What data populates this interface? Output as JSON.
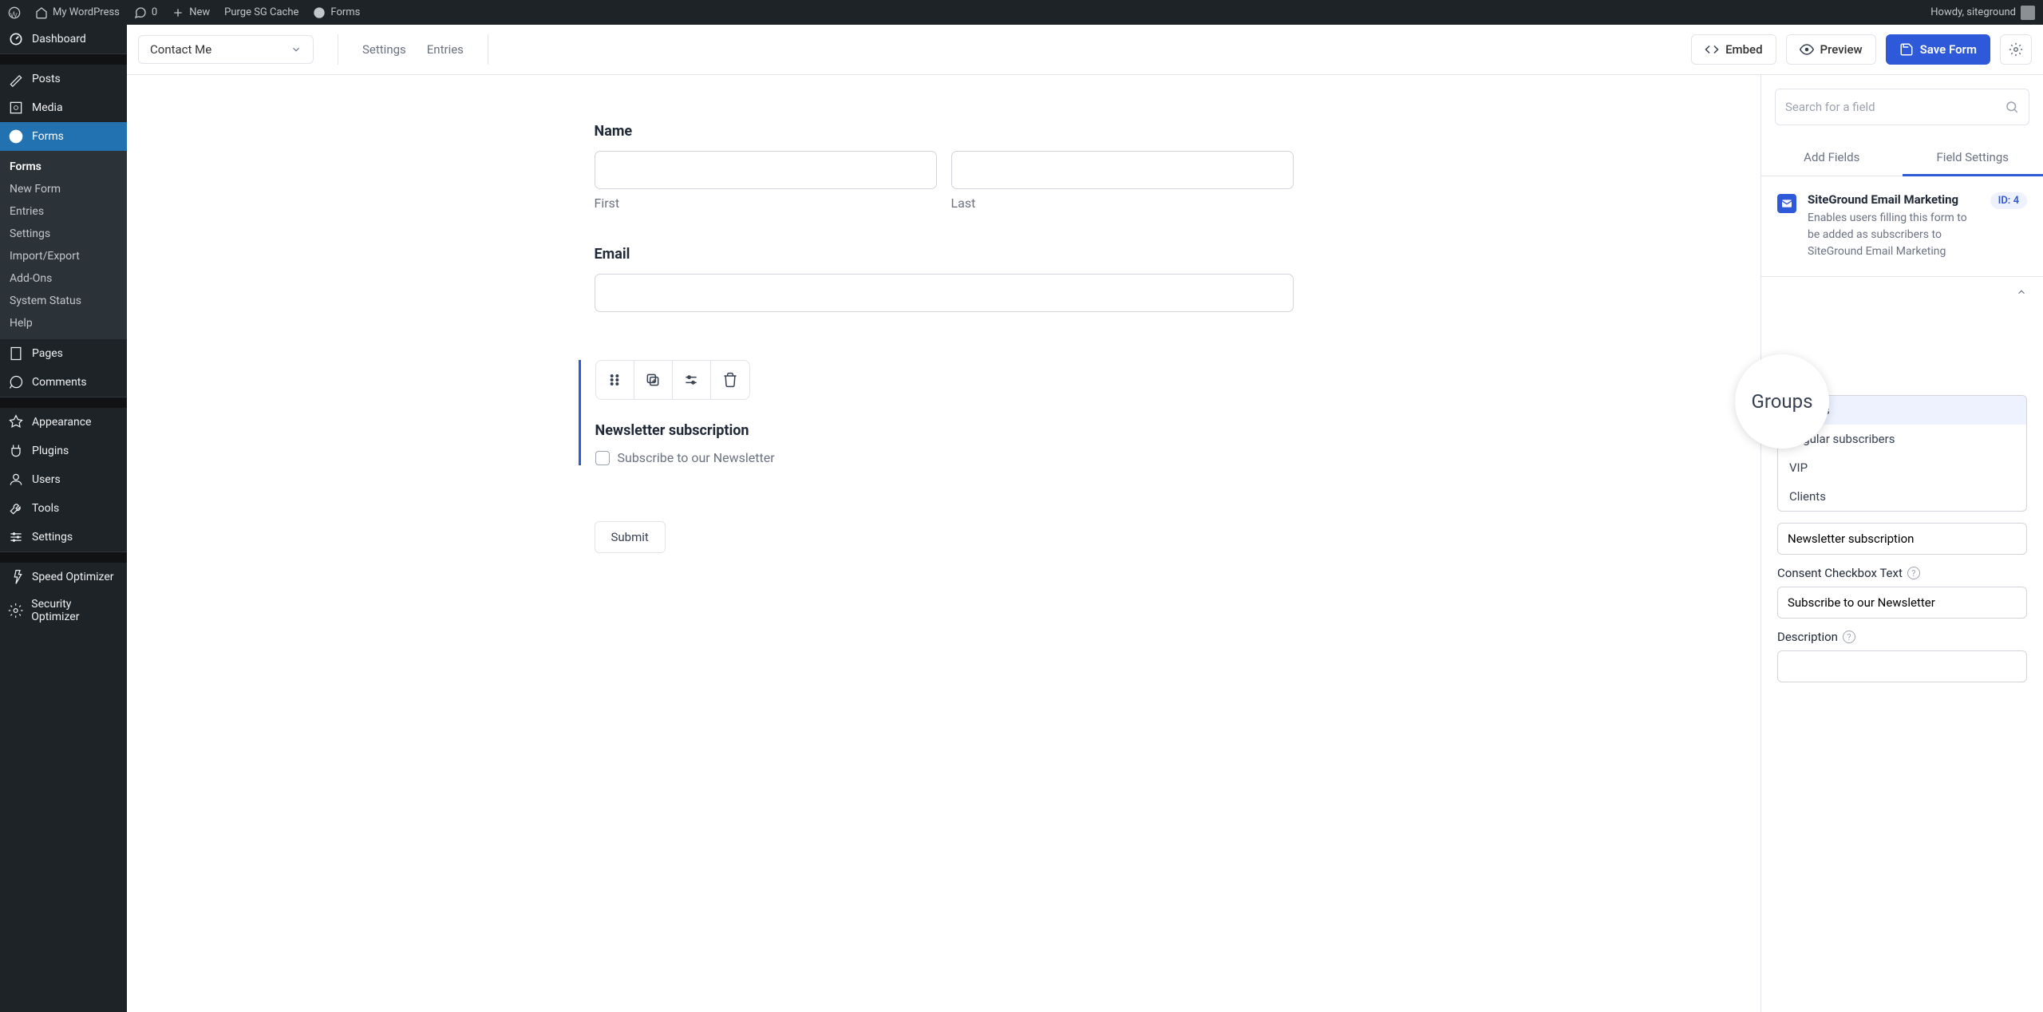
{
  "adminbar": {
    "site_name": "My WordPress",
    "comments_count": "0",
    "new_label": "New",
    "purge_cache": "Purge SG Cache",
    "forms_label": "Forms",
    "greeting": "Howdy, siteground"
  },
  "sidebar": {
    "items": [
      {
        "label": "Dashboard"
      },
      {
        "label": "Posts"
      },
      {
        "label": "Media"
      },
      {
        "label": "Forms",
        "active": true
      },
      {
        "label": "Pages"
      },
      {
        "label": "Comments"
      },
      {
        "label": "Appearance"
      },
      {
        "label": "Plugins"
      },
      {
        "label": "Users"
      },
      {
        "label": "Tools"
      },
      {
        "label": "Settings"
      },
      {
        "label": "Speed Optimizer"
      },
      {
        "label": "Security Optimizer"
      }
    ],
    "forms_sub": [
      {
        "label": "Forms",
        "current": true
      },
      {
        "label": "New Form"
      },
      {
        "label": "Entries"
      },
      {
        "label": "Settings"
      },
      {
        "label": "Import/Export"
      },
      {
        "label": "Add-Ons"
      },
      {
        "label": "System Status"
      },
      {
        "label": "Help"
      }
    ]
  },
  "toolbar": {
    "current_form": "Contact Me",
    "tabs": {
      "settings": "Settings",
      "entries": "Entries"
    },
    "embed": "Embed",
    "preview": "Preview",
    "save": "Save Form"
  },
  "form": {
    "name_label": "Name",
    "first_sub": "First",
    "last_sub": "Last",
    "email_label": "Email",
    "newsletter_label": "Newsletter subscription",
    "newsletter_option": "Subscribe to our Newsletter",
    "submit_label": "Submit"
  },
  "panel": {
    "search_placeholder": "Search for a field",
    "tabs": {
      "add": "Add Fields",
      "settings": "Field Settings"
    },
    "field_info": {
      "title": "SiteGround Email Marketing",
      "desc": "Enables users filling this form to be added as subscribers to SiteGround Email Marketing",
      "id": "ID: 4"
    },
    "groups_bubble": "Groups",
    "dropdown": [
      {
        "label": "Visitors",
        "highlighted": true
      },
      {
        "label": "Regular subscribers"
      },
      {
        "label": "VIP"
      },
      {
        "label": "Clients"
      }
    ],
    "label_setting_value": "Newsletter subscription",
    "consent_label": "Consent Checkbox Text",
    "consent_value": "Subscribe to our Newsletter",
    "description_label": "Description"
  }
}
